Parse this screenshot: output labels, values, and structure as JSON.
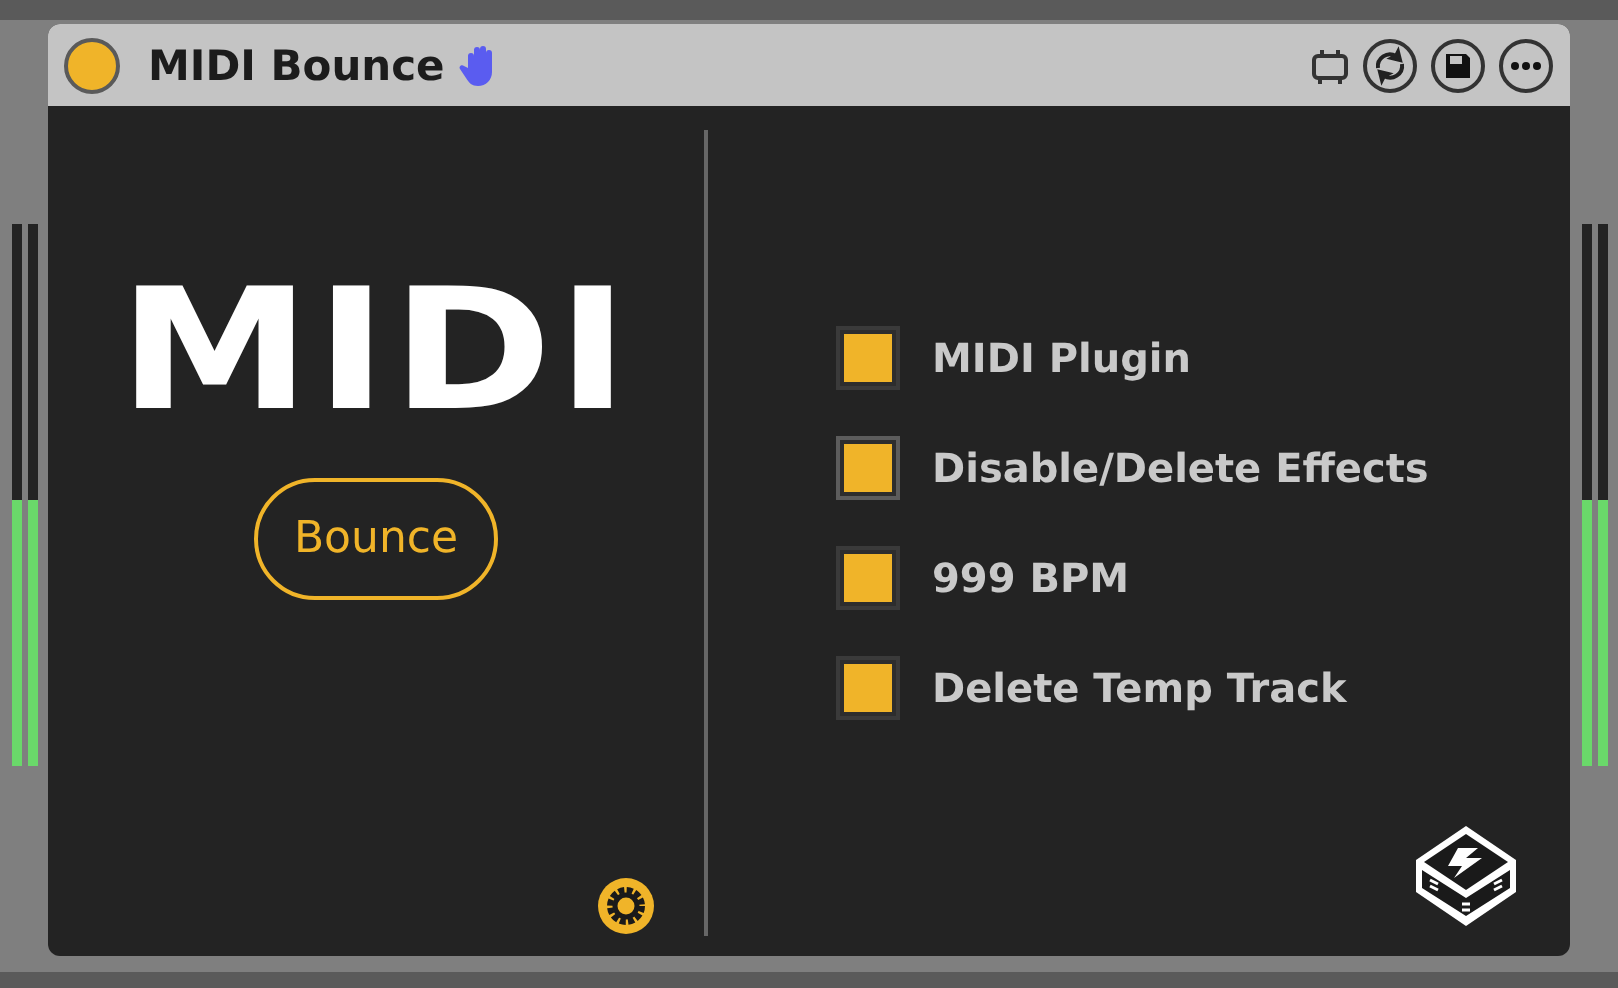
{
  "window": {
    "title": "MIDI Bounce",
    "active": true
  },
  "logo_text": "MIDI",
  "bounce_button": {
    "label": "Bounce"
  },
  "options": [
    {
      "label": "MIDI Plugin",
      "checked": true,
      "focused": false
    },
    {
      "label": "Disable/Delete Effects",
      "checked": true,
      "focused": true
    },
    {
      "label": "999 BPM",
      "checked": true,
      "focused": false
    },
    {
      "label": "Delete Temp Track",
      "checked": true,
      "focused": false
    }
  ],
  "left_meter": {
    "channels": [
      {
        "level": 0.49
      },
      {
        "level": 0.49
      }
    ]
  },
  "right_meter": {
    "channels": [
      {
        "level": 0.49
      },
      {
        "level": 0.49
      }
    ]
  }
}
